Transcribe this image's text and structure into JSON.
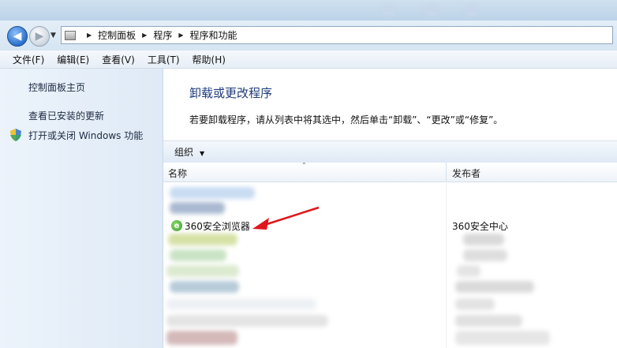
{
  "breadcrumb": [
    "控制面板",
    "程序",
    "程序和功能"
  ],
  "menu": [
    "文件(F)",
    "编辑(E)",
    "查看(V)",
    "工具(T)",
    "帮助(H)"
  ],
  "left_pane": {
    "home_link": "控制面板主页",
    "updates_link": "查看已安装的更新",
    "features_link": "打开或关闭 Windows 功能"
  },
  "content": {
    "title": "卸载或更改程序",
    "description": "若要卸载程序，请从列表中将其选中，然后单击“卸载”、“更改”或“修复”。",
    "toolbar": {
      "organize": "组织"
    },
    "columns": {
      "name": "名称",
      "publisher": "发布者"
    },
    "visible_program": {
      "name": "360安全浏览器",
      "publisher": "360安全中心"
    }
  },
  "colors": {
    "title": "#1e3b7a",
    "arrow": "#e0161b",
    "accent": "#2a6fc9"
  }
}
